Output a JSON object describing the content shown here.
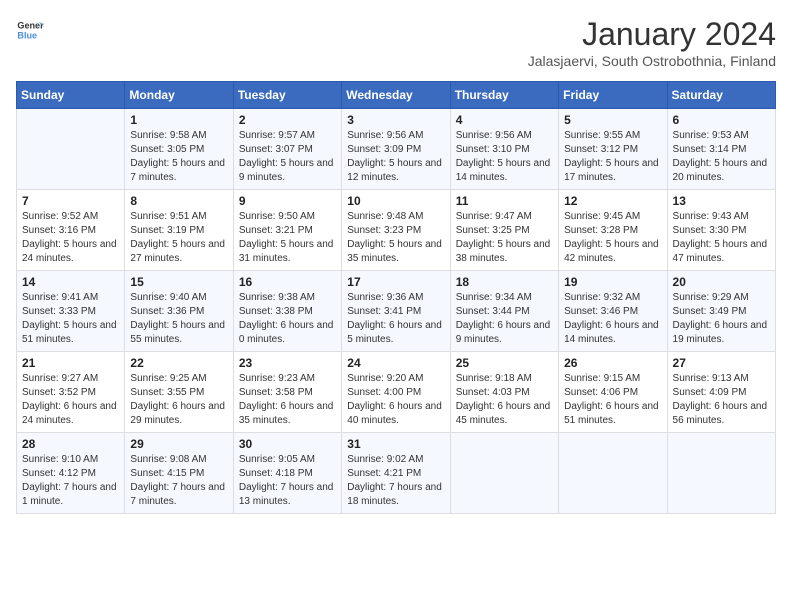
{
  "logo": {
    "line1": "General",
    "line2": "Blue"
  },
  "title": "January 2024",
  "subtitle": "Jalasjaervi, South Ostrobothnia, Finland",
  "days_of_week": [
    "Sunday",
    "Monday",
    "Tuesday",
    "Wednesday",
    "Thursday",
    "Friday",
    "Saturday"
  ],
  "weeks": [
    [
      {
        "day": "",
        "sunrise": "",
        "sunset": "",
        "daylight": ""
      },
      {
        "day": "1",
        "sunrise": "9:58 AM",
        "sunset": "3:05 PM",
        "daylight": "5 hours and 7 minutes."
      },
      {
        "day": "2",
        "sunrise": "9:57 AM",
        "sunset": "3:07 PM",
        "daylight": "5 hours and 9 minutes."
      },
      {
        "day": "3",
        "sunrise": "9:56 AM",
        "sunset": "3:09 PM",
        "daylight": "5 hours and 12 minutes."
      },
      {
        "day": "4",
        "sunrise": "9:56 AM",
        "sunset": "3:10 PM",
        "daylight": "5 hours and 14 minutes."
      },
      {
        "day": "5",
        "sunrise": "9:55 AM",
        "sunset": "3:12 PM",
        "daylight": "5 hours and 17 minutes."
      },
      {
        "day": "6",
        "sunrise": "9:53 AM",
        "sunset": "3:14 PM",
        "daylight": "5 hours and 20 minutes."
      }
    ],
    [
      {
        "day": "7",
        "sunrise": "9:52 AM",
        "sunset": "3:16 PM",
        "daylight": "5 hours and 24 minutes."
      },
      {
        "day": "8",
        "sunrise": "9:51 AM",
        "sunset": "3:19 PM",
        "daylight": "5 hours and 27 minutes."
      },
      {
        "day": "9",
        "sunrise": "9:50 AM",
        "sunset": "3:21 PM",
        "daylight": "5 hours and 31 minutes."
      },
      {
        "day": "10",
        "sunrise": "9:48 AM",
        "sunset": "3:23 PM",
        "daylight": "5 hours and 35 minutes."
      },
      {
        "day": "11",
        "sunrise": "9:47 AM",
        "sunset": "3:25 PM",
        "daylight": "5 hours and 38 minutes."
      },
      {
        "day": "12",
        "sunrise": "9:45 AM",
        "sunset": "3:28 PM",
        "daylight": "5 hours and 42 minutes."
      },
      {
        "day": "13",
        "sunrise": "9:43 AM",
        "sunset": "3:30 PM",
        "daylight": "5 hours and 47 minutes."
      }
    ],
    [
      {
        "day": "14",
        "sunrise": "9:41 AM",
        "sunset": "3:33 PM",
        "daylight": "5 hours and 51 minutes."
      },
      {
        "day": "15",
        "sunrise": "9:40 AM",
        "sunset": "3:36 PM",
        "daylight": "5 hours and 55 minutes."
      },
      {
        "day": "16",
        "sunrise": "9:38 AM",
        "sunset": "3:38 PM",
        "daylight": "6 hours and 0 minutes."
      },
      {
        "day": "17",
        "sunrise": "9:36 AM",
        "sunset": "3:41 PM",
        "daylight": "6 hours and 5 minutes."
      },
      {
        "day": "18",
        "sunrise": "9:34 AM",
        "sunset": "3:44 PM",
        "daylight": "6 hours and 9 minutes."
      },
      {
        "day": "19",
        "sunrise": "9:32 AM",
        "sunset": "3:46 PM",
        "daylight": "6 hours and 14 minutes."
      },
      {
        "day": "20",
        "sunrise": "9:29 AM",
        "sunset": "3:49 PM",
        "daylight": "6 hours and 19 minutes."
      }
    ],
    [
      {
        "day": "21",
        "sunrise": "9:27 AM",
        "sunset": "3:52 PM",
        "daylight": "6 hours and 24 minutes."
      },
      {
        "day": "22",
        "sunrise": "9:25 AM",
        "sunset": "3:55 PM",
        "daylight": "6 hours and 29 minutes."
      },
      {
        "day": "23",
        "sunrise": "9:23 AM",
        "sunset": "3:58 PM",
        "daylight": "6 hours and 35 minutes."
      },
      {
        "day": "24",
        "sunrise": "9:20 AM",
        "sunset": "4:00 PM",
        "daylight": "6 hours and 40 minutes."
      },
      {
        "day": "25",
        "sunrise": "9:18 AM",
        "sunset": "4:03 PM",
        "daylight": "6 hours and 45 minutes."
      },
      {
        "day": "26",
        "sunrise": "9:15 AM",
        "sunset": "4:06 PM",
        "daylight": "6 hours and 51 minutes."
      },
      {
        "day": "27",
        "sunrise": "9:13 AM",
        "sunset": "4:09 PM",
        "daylight": "6 hours and 56 minutes."
      }
    ],
    [
      {
        "day": "28",
        "sunrise": "9:10 AM",
        "sunset": "4:12 PM",
        "daylight": "7 hours and 1 minute."
      },
      {
        "day": "29",
        "sunrise": "9:08 AM",
        "sunset": "4:15 PM",
        "daylight": "7 hours and 7 minutes."
      },
      {
        "day": "30",
        "sunrise": "9:05 AM",
        "sunset": "4:18 PM",
        "daylight": "7 hours and 13 minutes."
      },
      {
        "day": "31",
        "sunrise": "9:02 AM",
        "sunset": "4:21 PM",
        "daylight": "7 hours and 18 minutes."
      },
      {
        "day": "",
        "sunrise": "",
        "sunset": "",
        "daylight": ""
      },
      {
        "day": "",
        "sunrise": "",
        "sunset": "",
        "daylight": ""
      },
      {
        "day": "",
        "sunrise": "",
        "sunset": "",
        "daylight": ""
      }
    ]
  ],
  "labels": {
    "sunrise_prefix": "Sunrise: ",
    "sunset_prefix": "Sunset: ",
    "daylight_prefix": "Daylight: "
  }
}
